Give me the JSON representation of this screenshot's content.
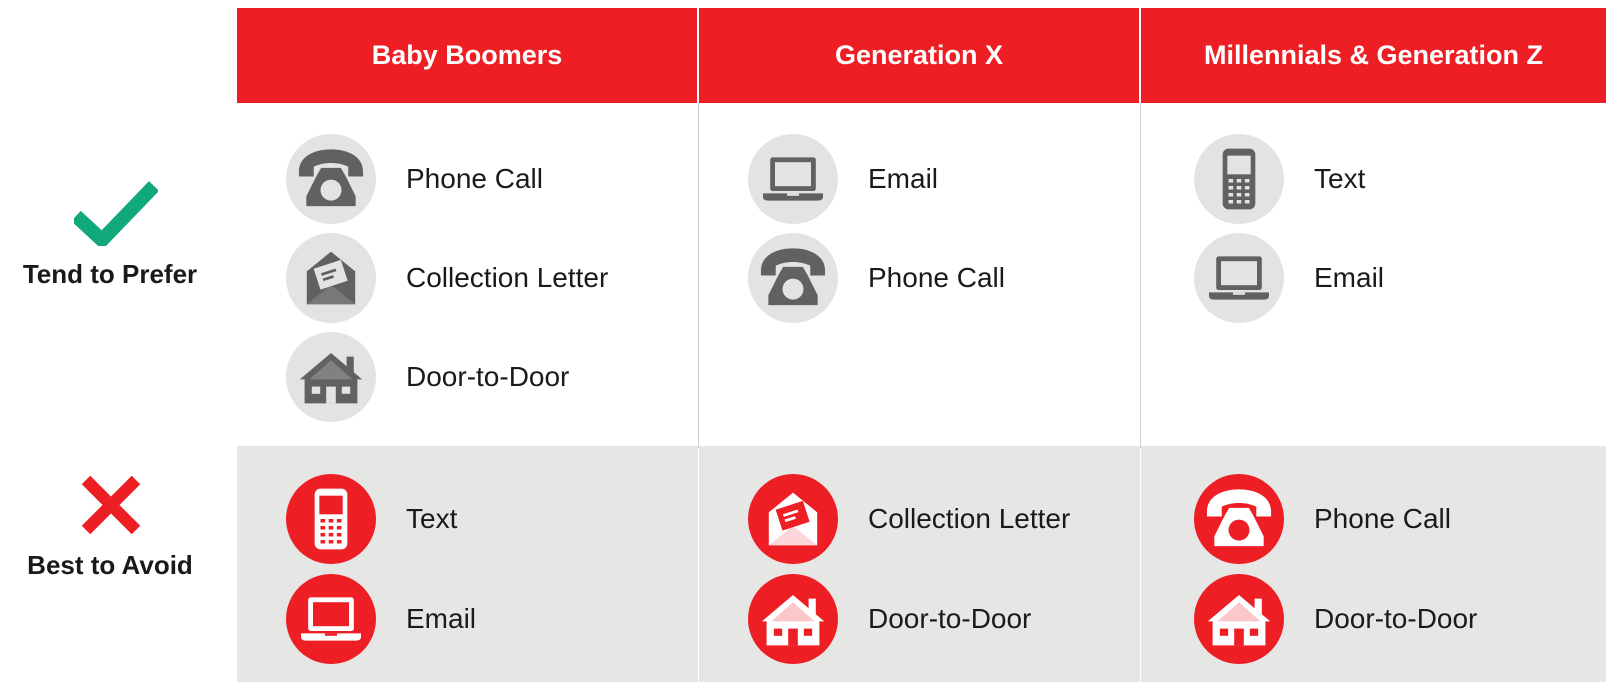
{
  "colors": {
    "header_bg": "#ee1e25",
    "check": "#11a87c",
    "cross": "#ee1e25",
    "icon_gray": "#616161",
    "icon_white": "#ffffff",
    "avoid_bg": "#e6e6e5"
  },
  "columns": [
    {
      "title": "Baby Boomers"
    },
    {
      "title": "Generation X"
    },
    {
      "title": "Millennials & Generation Z"
    }
  ],
  "rows": {
    "prefer": {
      "label": "Tend to Prefer",
      "icon": "check-icon"
    },
    "avoid": {
      "label": "Best to Avoid",
      "icon": "cross-icon"
    }
  },
  "cells": {
    "boomers_prefer": [
      {
        "label": "Phone Call",
        "icon": "phone-icon"
      },
      {
        "label": "Collection Letter",
        "icon": "letter-icon"
      },
      {
        "label": "Door-to-Door",
        "icon": "house-icon"
      }
    ],
    "genx_prefer": [
      {
        "label": "Email",
        "icon": "laptop-icon"
      },
      {
        "label": "Phone Call",
        "icon": "phone-icon"
      }
    ],
    "millennials_prefer": [
      {
        "label": "Text",
        "icon": "mobile-icon"
      },
      {
        "label": "Email",
        "icon": "laptop-icon"
      }
    ],
    "boomers_avoid": [
      {
        "label": "Text",
        "icon": "mobile-icon"
      },
      {
        "label": "Email",
        "icon": "laptop-icon"
      }
    ],
    "genx_avoid": [
      {
        "label": "Collection Letter",
        "icon": "letter-icon"
      },
      {
        "label": "Door-to-Door",
        "icon": "house-icon"
      }
    ],
    "millennials_avoid": [
      {
        "label": "Phone Call",
        "icon": "phone-icon"
      },
      {
        "label": "Door-to-Door",
        "icon": "house-icon"
      }
    ]
  }
}
